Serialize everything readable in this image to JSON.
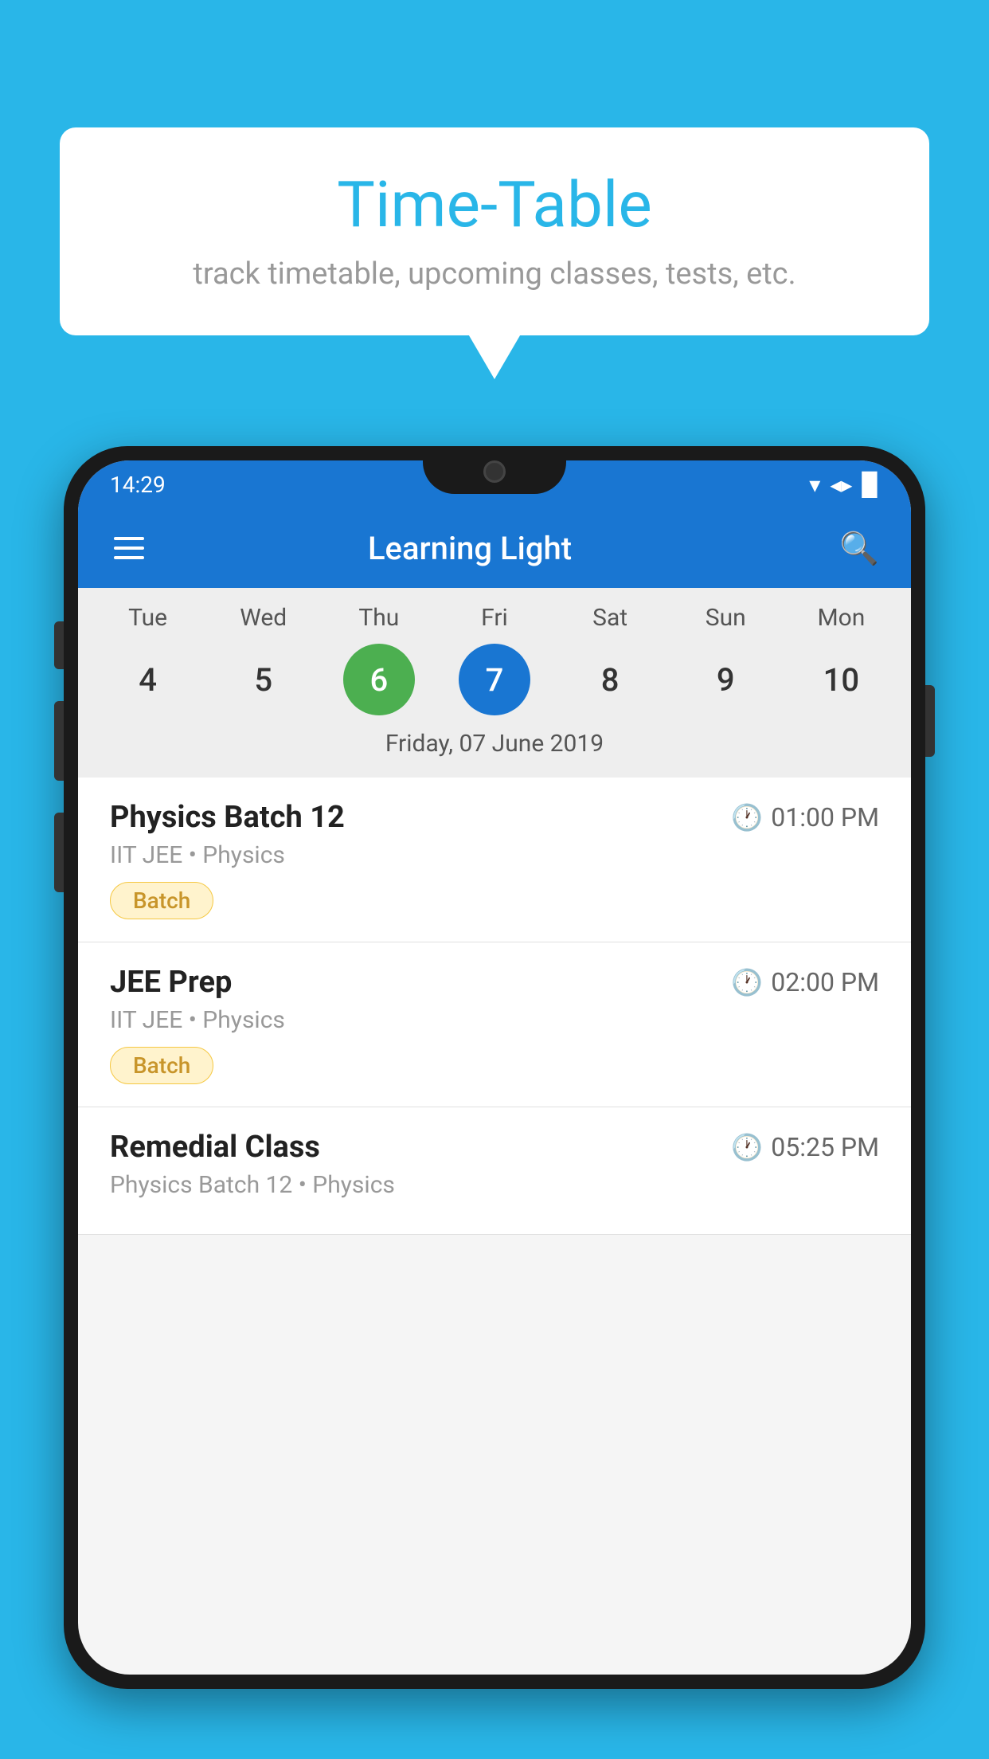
{
  "background_color": "#29B6E8",
  "bubble": {
    "title": "Time-Table",
    "subtitle": "track timetable, upcoming classes, tests, etc."
  },
  "phone": {
    "status_bar": {
      "time": "14:29",
      "icons": [
        "wifi",
        "signal",
        "battery"
      ]
    },
    "app_bar": {
      "title": "Learning Light",
      "menu_icon": "hamburger",
      "search_icon": "search"
    },
    "calendar": {
      "days": [
        {
          "label": "Tue",
          "number": "4"
        },
        {
          "label": "Wed",
          "number": "5"
        },
        {
          "label": "Thu",
          "number": "6",
          "state": "today"
        },
        {
          "label": "Fri",
          "number": "7",
          "state": "selected"
        },
        {
          "label": "Sat",
          "number": "8"
        },
        {
          "label": "Sun",
          "number": "9"
        },
        {
          "label": "Mon",
          "number": "10"
        }
      ],
      "selected_date_label": "Friday, 07 June 2019"
    },
    "schedule": [
      {
        "title": "Physics Batch 12",
        "time": "01:00 PM",
        "subtitle": "IIT JEE • Physics",
        "badge": "Batch"
      },
      {
        "title": "JEE Prep",
        "time": "02:00 PM",
        "subtitle": "IIT JEE • Physics",
        "badge": "Batch"
      },
      {
        "title": "Remedial Class",
        "time": "05:25 PM",
        "subtitle": "Physics Batch 12 • Physics",
        "badge": null
      }
    ]
  }
}
